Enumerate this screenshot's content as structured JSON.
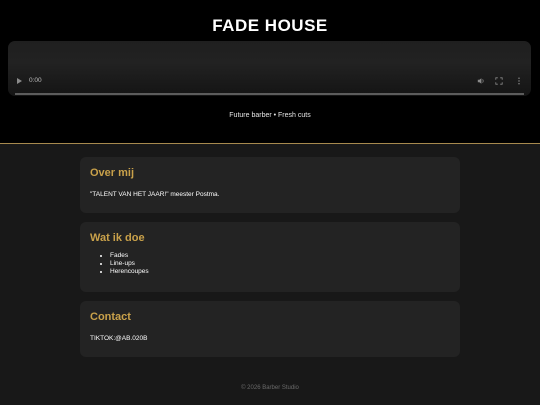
{
  "header": {
    "title": "FADE HOUSE",
    "tagline": "Future barber • Fresh cuts"
  },
  "video": {
    "time": "0:00",
    "progress": 0
  },
  "about": {
    "heading": "Over mij",
    "text": "\"TALENT VAN HET JAAR!\" meester Postma."
  },
  "services": {
    "heading": "Wat ik doe",
    "items": [
      "Fades",
      "Line-ups",
      "Herencoupes"
    ]
  },
  "contact": {
    "heading": "Contact",
    "text": "TIKTOK:@AB.020B"
  },
  "footer": {
    "text": "© 2026 Barber Studio"
  },
  "colors": {
    "accent": "#c9a14a",
    "background": "#181818",
    "card": "#232323",
    "header": "#000000"
  }
}
